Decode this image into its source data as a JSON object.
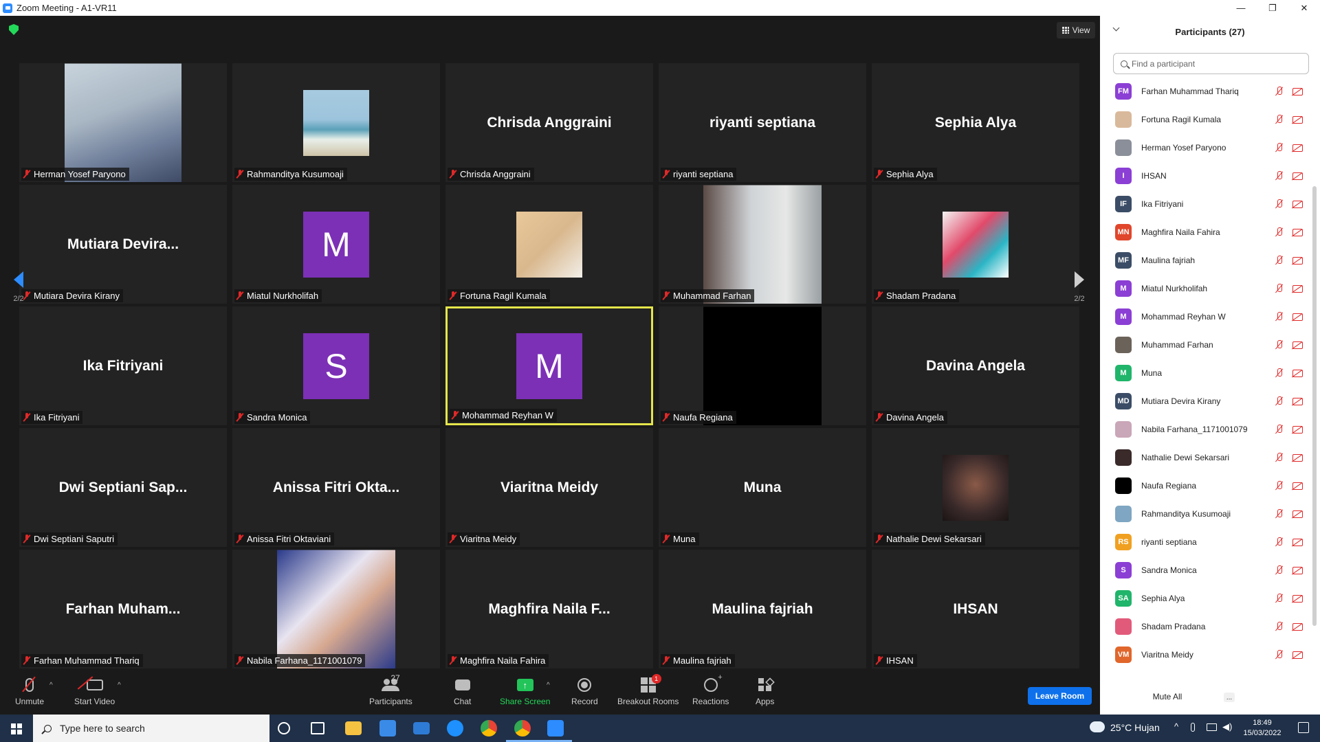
{
  "window": {
    "title": "Zoom Meeting - A1-VR11",
    "min": "—",
    "max": "❐",
    "close": "✕"
  },
  "top": {
    "view_label": "View"
  },
  "tiles": [
    {
      "big": "",
      "label": "Herman Yosef Paryono",
      "kind": "photo",
      "photo": "herman"
    },
    {
      "big": "",
      "label": "Rahmanditya Kusumoaji",
      "kind": "photo",
      "photo": "beach"
    },
    {
      "big": "Chrisda Anggraini",
      "label": "Chrisda Anggraini",
      "kind": "name"
    },
    {
      "big": "riyanti septiana",
      "label": "riyanti septiana",
      "kind": "name"
    },
    {
      "big": "Sephia Alya",
      "label": "Sephia Alya",
      "kind": "name"
    },
    {
      "big": "Mutiara  Devira...",
      "label": "Mutiara Devira Kirany",
      "kind": "name"
    },
    {
      "big": "M",
      "label": "Miatul Nurkholifah",
      "kind": "avatar"
    },
    {
      "big": "",
      "label": "Fortuna Ragil Kumala",
      "kind": "photo",
      "photo": "fortuna"
    },
    {
      "big": "",
      "label": "Muhammad Farhan",
      "kind": "photo",
      "photo": "farhan"
    },
    {
      "big": "",
      "label": "Shadam Pradana",
      "kind": "photo",
      "photo": "shadam"
    },
    {
      "big": "Ika Fitriyani",
      "label": "Ika Fitriyani",
      "kind": "name"
    },
    {
      "big": "S",
      "label": "Sandra Monica",
      "kind": "avatar"
    },
    {
      "big": "M",
      "label": "Mohammad Reyhan W",
      "kind": "avatar",
      "active": true
    },
    {
      "big": "",
      "label": "Naufa Regiana",
      "kind": "photo",
      "photo": "black"
    },
    {
      "big": "Davina Angela",
      "label": "Davina Angela",
      "kind": "name"
    },
    {
      "big": "Dwi  Septiani  Sap...",
      "label": "Dwi Septiani Saputri",
      "kind": "name"
    },
    {
      "big": "Anissa  Fitri  Okta...",
      "label": "Anissa Fitri Oktaviani",
      "kind": "name"
    },
    {
      "big": "Viaritna  Meidy",
      "label": "Viaritna Meidy",
      "kind": "name"
    },
    {
      "big": "Muna",
      "label": "Muna",
      "kind": "name"
    },
    {
      "big": "",
      "label": "Nathalie Dewi Sekarsari",
      "kind": "photo",
      "photo": "nathalie"
    },
    {
      "big": "Farhan  Muham...",
      "label": "Farhan Muhammad Thariq",
      "kind": "name"
    },
    {
      "big": "",
      "label": "Nabila Farhana_1171001079",
      "kind": "photo",
      "photo": "nabila"
    },
    {
      "big": "Maghfira  Naila  F...",
      "label": "Maghfira Naila Fahira",
      "kind": "name"
    },
    {
      "big": "Maulina  fajriah",
      "label": "Maulina fajriah",
      "kind": "name"
    },
    {
      "big": "IHSAN",
      "label": "IHSAN",
      "kind": "name"
    }
  ],
  "pager": {
    "left": "2/2",
    "right": "2/2"
  },
  "toolbar": {
    "unmute": "Unmute",
    "start_video": "Start Video",
    "participants": "Participants",
    "participants_count": "27",
    "chat": "Chat",
    "share_screen": "Share Screen",
    "record": "Record",
    "breakout": "Breakout Rooms",
    "breakout_badge": "1",
    "reactions": "Reactions",
    "apps": "Apps",
    "leave": "Leave Room"
  },
  "panel": {
    "title": "Participants (27)",
    "search_placeholder": "Find a participant",
    "mute_all": "Mute All",
    "more": "...",
    "participants": [
      {
        "initials": "FM",
        "name": "Farhan Muhammad Thariq",
        "color": "#8b3fd4"
      },
      {
        "initials": "",
        "name": "Fortuna Ragil Kumala",
        "color": "#d9b99b"
      },
      {
        "initials": "",
        "name": "Herman Yosef Paryono",
        "color": "#8a8f99"
      },
      {
        "initials": "I",
        "name": "IHSAN",
        "color": "#8b3fd4"
      },
      {
        "initials": "IF",
        "name": "Ika Fitriyani",
        "color": "#3b4d66"
      },
      {
        "initials": "MN",
        "name": "Maghfira Naila Fahira",
        "color": "#e0462b"
      },
      {
        "initials": "MF",
        "name": "Maulina fajriah",
        "color": "#3b4d66"
      },
      {
        "initials": "M",
        "name": "Miatul Nurkholifah",
        "color": "#8b3fd4"
      },
      {
        "initials": "M",
        "name": "Mohammad Reyhan W",
        "color": "#8b3fd4"
      },
      {
        "initials": "",
        "name": "Muhammad Farhan",
        "color": "#6b625a"
      },
      {
        "initials": "M",
        "name": "Muna",
        "color": "#20b56a"
      },
      {
        "initials": "MD",
        "name": "Mutiara Devira Kirany",
        "color": "#3b4d66"
      },
      {
        "initials": "",
        "name": "Nabila Farhana_1171001079",
        "color": "#c9a6b8"
      },
      {
        "initials": "",
        "name": "Nathalie Dewi Sekarsari",
        "color": "#3a2a2a"
      },
      {
        "initials": "",
        "name": "Naufa Regiana",
        "color": "#000000"
      },
      {
        "initials": "",
        "name": "Rahmanditya Kusumoaji",
        "color": "#7fa6c2"
      },
      {
        "initials": "RS",
        "name": "riyanti septiana",
        "color": "#f0a020"
      },
      {
        "initials": "S",
        "name": "Sandra Monica",
        "color": "#8b3fd4"
      },
      {
        "initials": "SA",
        "name": "Sephia Alya",
        "color": "#20b56a"
      },
      {
        "initials": "",
        "name": "Shadam Pradana",
        "color": "#e25a7a"
      },
      {
        "initials": "VM",
        "name": "Viaritna Meidy",
        "color": "#e0662b"
      }
    ]
  },
  "taskbar": {
    "search_placeholder": "Type here to search",
    "weather": "25°C  Hujan",
    "time": "18:49",
    "date": "15/03/2022"
  }
}
